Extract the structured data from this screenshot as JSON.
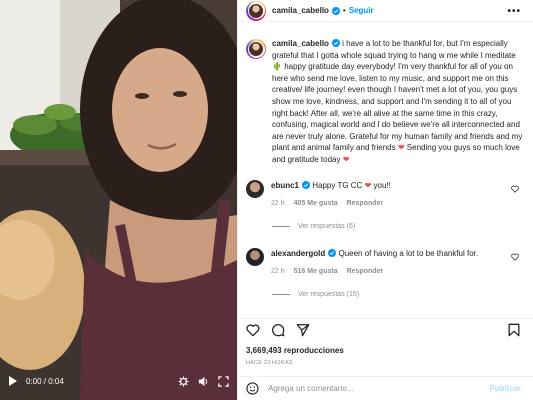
{
  "header": {
    "username": "camila_cabello",
    "separator": "•",
    "follow_label": "Seguir",
    "more": "•••"
  },
  "caption": {
    "username": "camila_cabello",
    "text_part1": " i have a lot to be thankful for, but I'm especially grateful that I gotta whole squad trying to hang w me while I meditate ",
    "text_part2": " happy gratitude day everybody! I'm very thankful for all of you on here who send me love, listen to my music, and support me on this creative/ life journey! even though I haven't met a lot of you, you guys show me love, kindness, and support and I'm sending it to all of you right back! After all, we're all alive at the same time in this crazy, confusing, magical world and I do believe we're all interconnected and are never truly alone. Grateful for my human family and friends and my plant and animal family and friends ",
    "text_part3": " Sending you guys so much love and gratitude today ",
    "emoji_plant": "🌵",
    "emoji_heart": "❤"
  },
  "comments": [
    {
      "username": "ebunc1",
      "text_before": " Happy TG CC ",
      "text_after": " you!!",
      "emoji": "❤",
      "time": "22 h",
      "likes": "405 Me gusta",
      "reply_label": "Responder",
      "view_replies": "Ver respuestas (6)"
    },
    {
      "username": "alexandergold",
      "text_before": " Queen of having a lot to be thankful for.",
      "text_after": "",
      "emoji": "",
      "time": "22 h",
      "likes": "516 Me gusta",
      "reply_label": "Responder",
      "view_replies": "Ver respuestas (15)"
    }
  ],
  "stats": {
    "views": "3,669,493 reproducciones",
    "posted": "HACE 23 HORAS"
  },
  "video": {
    "time": "0:00 / 0:04"
  },
  "add_comment": {
    "placeholder": "Agrega un comentario...",
    "publish_label": "Publicar"
  },
  "colors": {
    "link_blue": "#0095f6",
    "heart_red": "#ed4956",
    "muted": "#8e8e8e"
  },
  "icons": [
    "play-icon",
    "settings-icon",
    "volume-icon",
    "fullscreen-icon",
    "verified-icon",
    "heart-icon",
    "comment-icon",
    "share-icon",
    "bookmark-icon",
    "emoji-icon"
  ]
}
